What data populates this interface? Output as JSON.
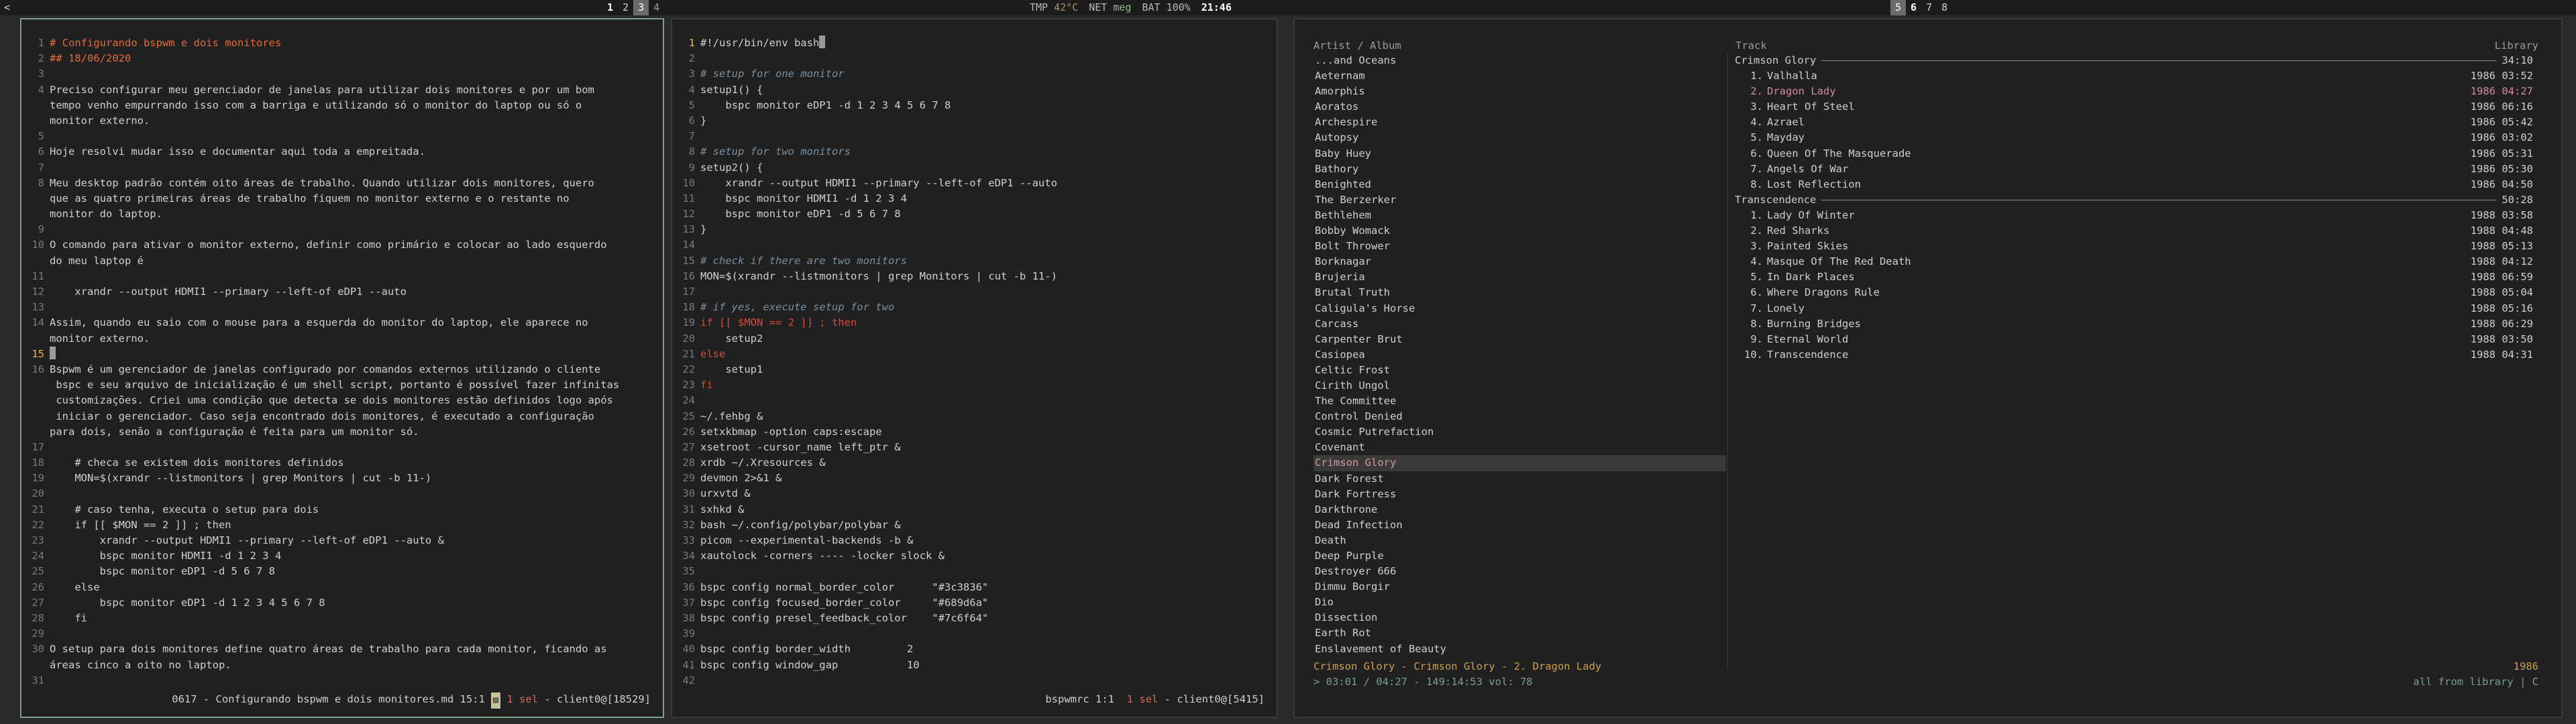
{
  "topbar": {
    "left_arrow": "<",
    "ws_left": [
      "1",
      "2",
      "3",
      "4"
    ],
    "ws_right": [
      "5",
      "6",
      "7",
      "8"
    ],
    "temp_label": "TMP",
    "temp_value": "42°C",
    "net_label": "NET",
    "net_value": "meg",
    "bat_label": "BAT",
    "bat_value": "100%",
    "time": "21:46"
  },
  "editor1": {
    "lines": [
      {
        "n": "1",
        "t": "# Configurando bspwm e dois monitores",
        "cls": "heading"
      },
      {
        "n": "2",
        "t": "## 18/06/2020",
        "cls": "heading"
      },
      {
        "n": "3",
        "t": ""
      },
      {
        "n": "4",
        "t": "Preciso configurar meu gerenciador de janelas para utilizar dois monitores e por um bom"
      },
      {
        "n": "",
        "t": "tempo venho empurrando isso com a barriga e utilizando só o monitor do laptop ou só o"
      },
      {
        "n": "",
        "t": "monitor externo."
      },
      {
        "n": "5",
        "t": ""
      },
      {
        "n": "6",
        "t": "Hoje resolvi mudar isso e documentar aqui toda a empreitada."
      },
      {
        "n": "7",
        "t": ""
      },
      {
        "n": "8",
        "t": "Meu desktop padrão contém oito áreas de trabalho. Quando utilizar dois monitores, quero"
      },
      {
        "n": "",
        "t": "que as quatro primeiras áreas de trabalho fiquem no monitor externo e o restante no"
      },
      {
        "n": "",
        "t": "monitor do laptop."
      },
      {
        "n": "9",
        "t": ""
      },
      {
        "n": "10",
        "t": "O comando para ativar o monitor externo, definir como primário e colocar ao lado esquerdo"
      },
      {
        "n": "",
        "t": "do meu laptop é"
      },
      {
        "n": "11",
        "t": ""
      },
      {
        "n": "12",
        "t": "    xrandr --output HDMI1 --primary --left-of eDP1 --auto"
      },
      {
        "n": "13",
        "t": ""
      },
      {
        "n": "14",
        "t": "Assim, quando eu saio com o mouse para a esquerda do monitor do laptop, ele aparece no"
      },
      {
        "n": "",
        "t": "monitor externo."
      },
      {
        "n": "15",
        "t": "",
        "cur": true
      },
      {
        "n": "16",
        "t": "Bspwm é um gerenciador de janelas configurado por comandos externos utilizando o cliente"
      },
      {
        "n": "",
        "t": " bspc e seu arquivo de inicialização é um shell script, portanto é possível fazer infinitas"
      },
      {
        "n": "",
        "t": " customizações. Criei uma condição que detecta se dois monitores estão definidos logo após"
      },
      {
        "n": "",
        "t": " iniciar o gerenciador. Caso seja encontrado dois monitores, é executado a configuração"
      },
      {
        "n": "",
        "t": "para dois, senão a configuração é feita para um monitor só."
      },
      {
        "n": "17",
        "t": ""
      },
      {
        "n": "18",
        "t": "    # checa se existem dois monitores definidos"
      },
      {
        "n": "19",
        "t": "    MON=$(xrandr --listmonitors | grep Monitors | cut -b 11-)"
      },
      {
        "n": "20",
        "t": ""
      },
      {
        "n": "21",
        "t": "    # caso tenha, executa o setup para dois"
      },
      {
        "n": "22",
        "t": "    if [[ $MON == 2 ]] ; then"
      },
      {
        "n": "23",
        "t": "        xrandr --output HDMI1 --primary --left-of eDP1 --auto &"
      },
      {
        "n": "24",
        "t": "        bspc monitor HDMI1 -d 1 2 3 4"
      },
      {
        "n": "25",
        "t": "        bspc monitor eDP1 -d 5 6 7 8"
      },
      {
        "n": "26",
        "t": "    else"
      },
      {
        "n": "27",
        "t": "        bspc monitor eDP1 -d 1 2 3 4 5 6 7 8"
      },
      {
        "n": "28",
        "t": "    fi"
      },
      {
        "n": "29",
        "t": ""
      },
      {
        "n": "30",
        "t": "O setup para dois monitores define quatro áreas de trabalho para cada monitor, ficando as"
      },
      {
        "n": "",
        "t": "áreas cinco a oito no laptop."
      },
      {
        "n": "31",
        "t": ""
      }
    ],
    "modeline_a": "0617 - Configurando bspwm e dois monitores.md 15:1",
    "modeline_b": "1 sel",
    "modeline_c": "- client0@[18529]"
  },
  "editor2": {
    "lines": [
      {
        "n": "1",
        "t": "#!/usr/bin/env bash",
        "cur": true
      },
      {
        "n": "2",
        "t": ""
      },
      {
        "n": "3",
        "t": "# setup for one monitor",
        "cls": "comment"
      },
      {
        "n": "4",
        "t": "setup1() {"
      },
      {
        "n": "5",
        "t": "    bspc monitor eDP1 -d 1 2 3 4 5 6 7 8"
      },
      {
        "n": "6",
        "t": "}"
      },
      {
        "n": "7",
        "t": ""
      },
      {
        "n": "8",
        "t": "# setup for two monitors",
        "cls": "comment"
      },
      {
        "n": "9",
        "t": "setup2() {"
      },
      {
        "n": "10",
        "t": "    xrandr --output HDMI1 --primary --left-of eDP1 --auto"
      },
      {
        "n": "11",
        "t": "    bspc monitor HDMI1 -d 1 2 3 4"
      },
      {
        "n": "12",
        "t": "    bspc monitor eDP1 -d 5 6 7 8"
      },
      {
        "n": "13",
        "t": "}"
      },
      {
        "n": "14",
        "t": ""
      },
      {
        "n": "15",
        "t": "# check if there are two monitors",
        "cls": "comment"
      },
      {
        "n": "16",
        "t": "MON=$(xrandr --listmonitors | grep Monitors | cut -b 11-)"
      },
      {
        "n": "17",
        "t": ""
      },
      {
        "n": "18",
        "t": "# if yes, execute setup for two",
        "cls": "comment"
      },
      {
        "n": "19",
        "t": "if [[ $MON == 2 ]] ; then",
        "cls": "kw"
      },
      {
        "n": "20",
        "t": "    setup2"
      },
      {
        "n": "21",
        "t": "else",
        "cls": "kw"
      },
      {
        "n": "22",
        "t": "    setup1"
      },
      {
        "n": "23",
        "t": "fi",
        "cls": "kw"
      },
      {
        "n": "24",
        "t": ""
      },
      {
        "n": "25",
        "t": "~/.fehbg &"
      },
      {
        "n": "26",
        "t": "setxkbmap -option caps:escape"
      },
      {
        "n": "27",
        "t": "xsetroot -cursor_name left_ptr &"
      },
      {
        "n": "28",
        "t": "xrdb ~/.Xresources &"
      },
      {
        "n": "29",
        "t": "devmon 2>&1 &"
      },
      {
        "n": "30",
        "t": "urxvtd &"
      },
      {
        "n": "31",
        "t": "sxhkd &"
      },
      {
        "n": "32",
        "t": "bash ~/.config/polybar/polybar &"
      },
      {
        "n": "33",
        "t": "picom --experimental-backends -b &"
      },
      {
        "n": "34",
        "t": "xautolock -corners ---- -locker slock &"
      },
      {
        "n": "35",
        "t": ""
      },
      {
        "n": "36",
        "t": "bspc config normal_border_color      \"#3c3836\""
      },
      {
        "n": "37",
        "t": "bspc config focused_border_color     \"#689d6a\""
      },
      {
        "n": "38",
        "t": "bspc config presel_feedback_color    \"#7c6f64\""
      },
      {
        "n": "39",
        "t": ""
      },
      {
        "n": "40",
        "t": "bspc config border_width         2"
      },
      {
        "n": "41",
        "t": "bspc config window_gap           10"
      },
      {
        "n": "42",
        "t": ""
      }
    ],
    "modeline_a": "bspwmrc 1:1",
    "modeline_b": "1 sel",
    "modeline_c": "- client0@[5415]"
  },
  "player": {
    "head_artist": "Artist / Album",
    "head_track": "Track",
    "head_library": "Library",
    "artists": [
      "...and Oceans",
      "Aeternam",
      "Amorphis",
      "Aoratos",
      "Archespire",
      "Autopsy",
      "Baby Huey",
      "Bathory",
      "Benighted",
      "The Berzerker",
      "Bethlehem",
      "Bobby Womack",
      "Bolt Thrower",
      "Borknagar",
      "Brujeria",
      "Brutal Truth",
      "Caligula's Horse",
      "Carcass",
      "Carpenter Brut",
      "Casiopea",
      "Celtic Frost",
      "Cirith Ungol",
      "The Committee",
      "Control Denied",
      "Cosmic Putrefaction",
      "Covenant",
      "Crimson Glory",
      "Dark Forest",
      "Dark Fortress",
      "Darkthrone",
      "Dead Infection",
      "Death",
      "Deep Purple",
      "Destroyer 666",
      "Dimmu Borgir",
      "Dio",
      "Dissection",
      "Earth Rot",
      "Enslavement of Beauty"
    ],
    "highlight_index": 26,
    "albums": [
      {
        "title": "Crimson Glory",
        "duration": "34:10",
        "tracks": [
          {
            "n": "1.",
            "t": "Valhalla",
            "y": "1986 03:52"
          },
          {
            "n": "2.",
            "t": "Dragon Lady",
            "y": "1986 04:27",
            "playing": true
          },
          {
            "n": "3.",
            "t": "Heart Of Steel",
            "y": "1986 06:16"
          },
          {
            "n": "4.",
            "t": "Azrael",
            "y": "1986 05:42"
          },
          {
            "n": "5.",
            "t": "Mayday",
            "y": "1986 03:02"
          },
          {
            "n": "6.",
            "t": "Queen Of The Masquerade",
            "y": "1986 05:31"
          },
          {
            "n": "7.",
            "t": "Angels Of War",
            "y": "1986 05:30"
          },
          {
            "n": "8.",
            "t": "Lost Reflection",
            "y": "1986 04:50"
          }
        ]
      },
      {
        "title": "Transcendence",
        "duration": "50:28",
        "tracks": [
          {
            "n": "1.",
            "t": "Lady Of Winter",
            "y": "1988 03:58"
          },
          {
            "n": "2.",
            "t": "Red Sharks",
            "y": "1988 04:48"
          },
          {
            "n": "3.",
            "t": "Painted Skies",
            "y": "1988 05:13"
          },
          {
            "n": "4.",
            "t": "Masque Of The Red Death",
            "y": "1988 04:12"
          },
          {
            "n": "5.",
            "t": "In Dark Places",
            "y": "1988 06:59"
          },
          {
            "n": "6.",
            "t": "Where Dragons Rule",
            "y": "1988 05:04"
          },
          {
            "n": "7.",
            "t": "Lonely",
            "y": "1988 05:16"
          },
          {
            "n": "8.",
            "t": "Burning Bridges",
            "y": "1988 06:29"
          },
          {
            "n": "9.",
            "t": "Eternal World",
            "y": "1988 03:50"
          },
          {
            "n": "10.",
            "t": "Transcendence",
            "y": "1988 04:31"
          }
        ]
      }
    ],
    "now_playing": "Crimson Glory - Crimson Glory -  2. Dragon Lady",
    "now_year": "1986",
    "progress": "> 03:01 / 04:27 - 149:14:53 vol: 78",
    "mode": "all from library | C"
  }
}
